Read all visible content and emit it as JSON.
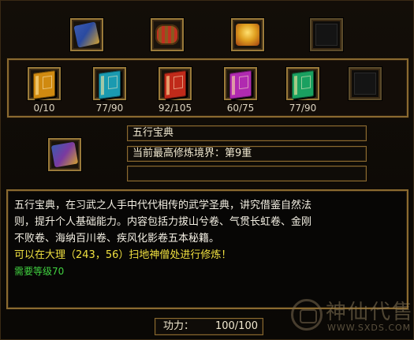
{
  "top_row": [
    {
      "icon": "bundle-books-icon",
      "colors": [
        "#2a4aa0",
        "#d0a030"
      ]
    },
    {
      "icon": "scroll-bundle-icon",
      "colors": [
        "#6a4a1a",
        "#c03020"
      ]
    },
    {
      "icon": "gold-treasure-icon",
      "colors": [
        "#c06010",
        "#f0c040"
      ]
    },
    {
      "icon": "empty-slot",
      "colors": []
    }
  ],
  "books": [
    {
      "color": "#d08a10",
      "count": "0/10"
    },
    {
      "color": "#1a9ab0",
      "count": "77/90"
    },
    {
      "color": "#c02a1a",
      "count": "92/105"
    },
    {
      "color": "#b02ab0",
      "count": "60/75"
    },
    {
      "color": "#1aa060",
      "count": "77/90"
    }
  ],
  "detail": {
    "name": "五行宝典",
    "realm": "当前最高修炼境界：第9重",
    "extra": ""
  },
  "description": {
    "line1": "五行宝典，在习武之人手中代代相传的武学圣典，讲究借鉴自然法",
    "line2": "则，提升个人基础能力。内容包括力拔山兮卷、气贯长虹卷、金刚",
    "line3": "不败卷、海纳百川卷、疾风化影卷五本秘籍。",
    "location": "可以在大理（243，56）扫地神僧处进行修炼！",
    "level": "需要等级70"
  },
  "power": {
    "label": "功力：",
    "value": "100/100"
  },
  "watermark": {
    "title": "神仙代售",
    "url": "WWW.SXDS.COM"
  }
}
